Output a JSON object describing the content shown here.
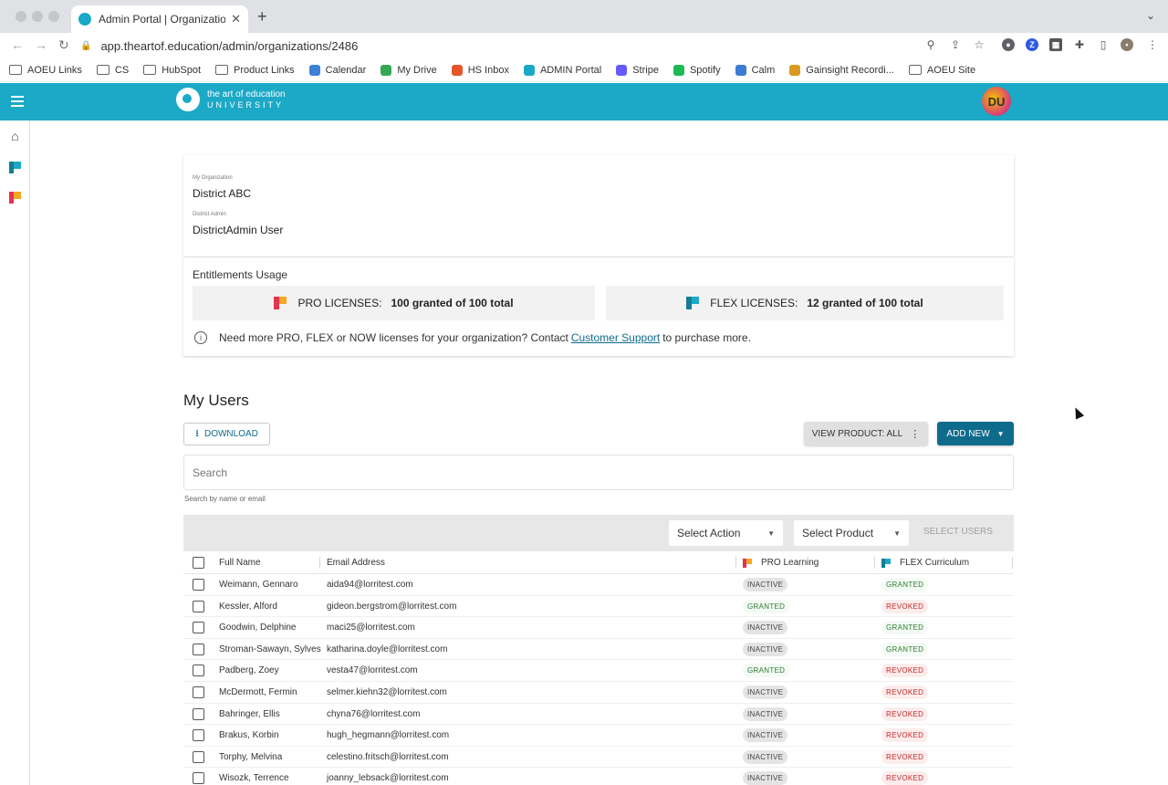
{
  "browser": {
    "tab_title": "Admin Portal | Organization Ma",
    "url": "app.theartof.education/admin/organizations/2486",
    "bookmarks": [
      {
        "label": "AOEU Links",
        "icon": "folder-icon"
      },
      {
        "label": "CS",
        "icon": "folder-icon"
      },
      {
        "label": "HubSpot",
        "icon": "folder-icon"
      },
      {
        "label": "Product Links",
        "icon": "folder-icon"
      },
      {
        "label": "Calendar",
        "icon": "calendar-icon"
      },
      {
        "label": "My Drive",
        "icon": "drive-icon"
      },
      {
        "label": "HS Inbox",
        "icon": "hubspot-icon"
      },
      {
        "label": "ADMIN Portal",
        "icon": "aoeu-icon"
      },
      {
        "label": "Stripe",
        "icon": "stripe-icon"
      },
      {
        "label": "Spotify",
        "icon": "spotify-icon"
      },
      {
        "label": "Calm",
        "icon": "calm-icon"
      },
      {
        "label": "Gainsight Recordi...",
        "icon": "gainsight-icon"
      },
      {
        "label": "AOEU Site",
        "icon": "folder-icon"
      }
    ]
  },
  "header": {
    "logo_line1": "the art of education",
    "logo_line2": "UNIVERSITY",
    "avatar_initials": "DU",
    "brand_color": "#1ba9c7"
  },
  "org": {
    "org_label": "My Organization",
    "org_name": "District ABC",
    "admin_label": "District Admin",
    "admin_name": "DistrictAdmin User"
  },
  "entitlements": {
    "title": "Entitlements Usage",
    "pro_label": "PRO LICENSES:",
    "pro_value": "100 granted of 100 total",
    "flex_label": "FLEX LICENSES:",
    "flex_value": "12 granted of 100 total",
    "info_text_before": "Need more PRO, FLEX or NOW licenses for your organization? Contact",
    "info_link": "Customer Support",
    "info_text_after": "to purchase more."
  },
  "users": {
    "title": "My Users",
    "download_label": "DOWNLOAD",
    "view_product_label": "VIEW PRODUCT: ALL",
    "add_new_label": "ADD NEW",
    "search_placeholder": "Search",
    "search_helper": "Search by name or email",
    "select_action": "Select Action",
    "select_product": "Select Product",
    "select_users_label": "SELECT USERS",
    "columns": {
      "name": "Full Name",
      "email": "Email Address",
      "pro": "PRO Learning",
      "flex": "FLEX Curriculum"
    },
    "rows": [
      {
        "name": "Weimann, Gennaro",
        "email": "aida94@lorritest.com",
        "pro": "INACTIVE",
        "flex": "GRANTED"
      },
      {
        "name": "Kessler, Alford",
        "email": "gideon.bergstrom@lorritest.com",
        "pro": "GRANTED",
        "flex": "REVOKED"
      },
      {
        "name": "Goodwin, Delphine",
        "email": "maci25@lorritest.com",
        "pro": "INACTIVE",
        "flex": "GRANTED"
      },
      {
        "name": "Stroman-Sawayn, Sylves",
        "email": "katharina.doyle@lorritest.com",
        "pro": "INACTIVE",
        "flex": "GRANTED"
      },
      {
        "name": "Padberg, Zoey",
        "email": "vesta47@lorritest.com",
        "pro": "GRANTED",
        "flex": "REVOKED"
      },
      {
        "name": "McDermott, Fermin",
        "email": "selmer.kiehn32@lorritest.com",
        "pro": "INACTIVE",
        "flex": "REVOKED"
      },
      {
        "name": "Bahringer, Ellis",
        "email": "chyna76@lorritest.com",
        "pro": "INACTIVE",
        "flex": "REVOKED"
      },
      {
        "name": "Brakus, Korbin",
        "email": "hugh_hegmann@lorritest.com",
        "pro": "INACTIVE",
        "flex": "REVOKED"
      },
      {
        "name": "Torphy, Melvina",
        "email": "celestino.fritsch@lorritest.com",
        "pro": "INACTIVE",
        "flex": "REVOKED"
      },
      {
        "name": "Wisozk, Terrence",
        "email": "joanny_lebsack@lorritest.com",
        "pro": "INACTIVE",
        "flex": "REVOKED"
      }
    ]
  }
}
